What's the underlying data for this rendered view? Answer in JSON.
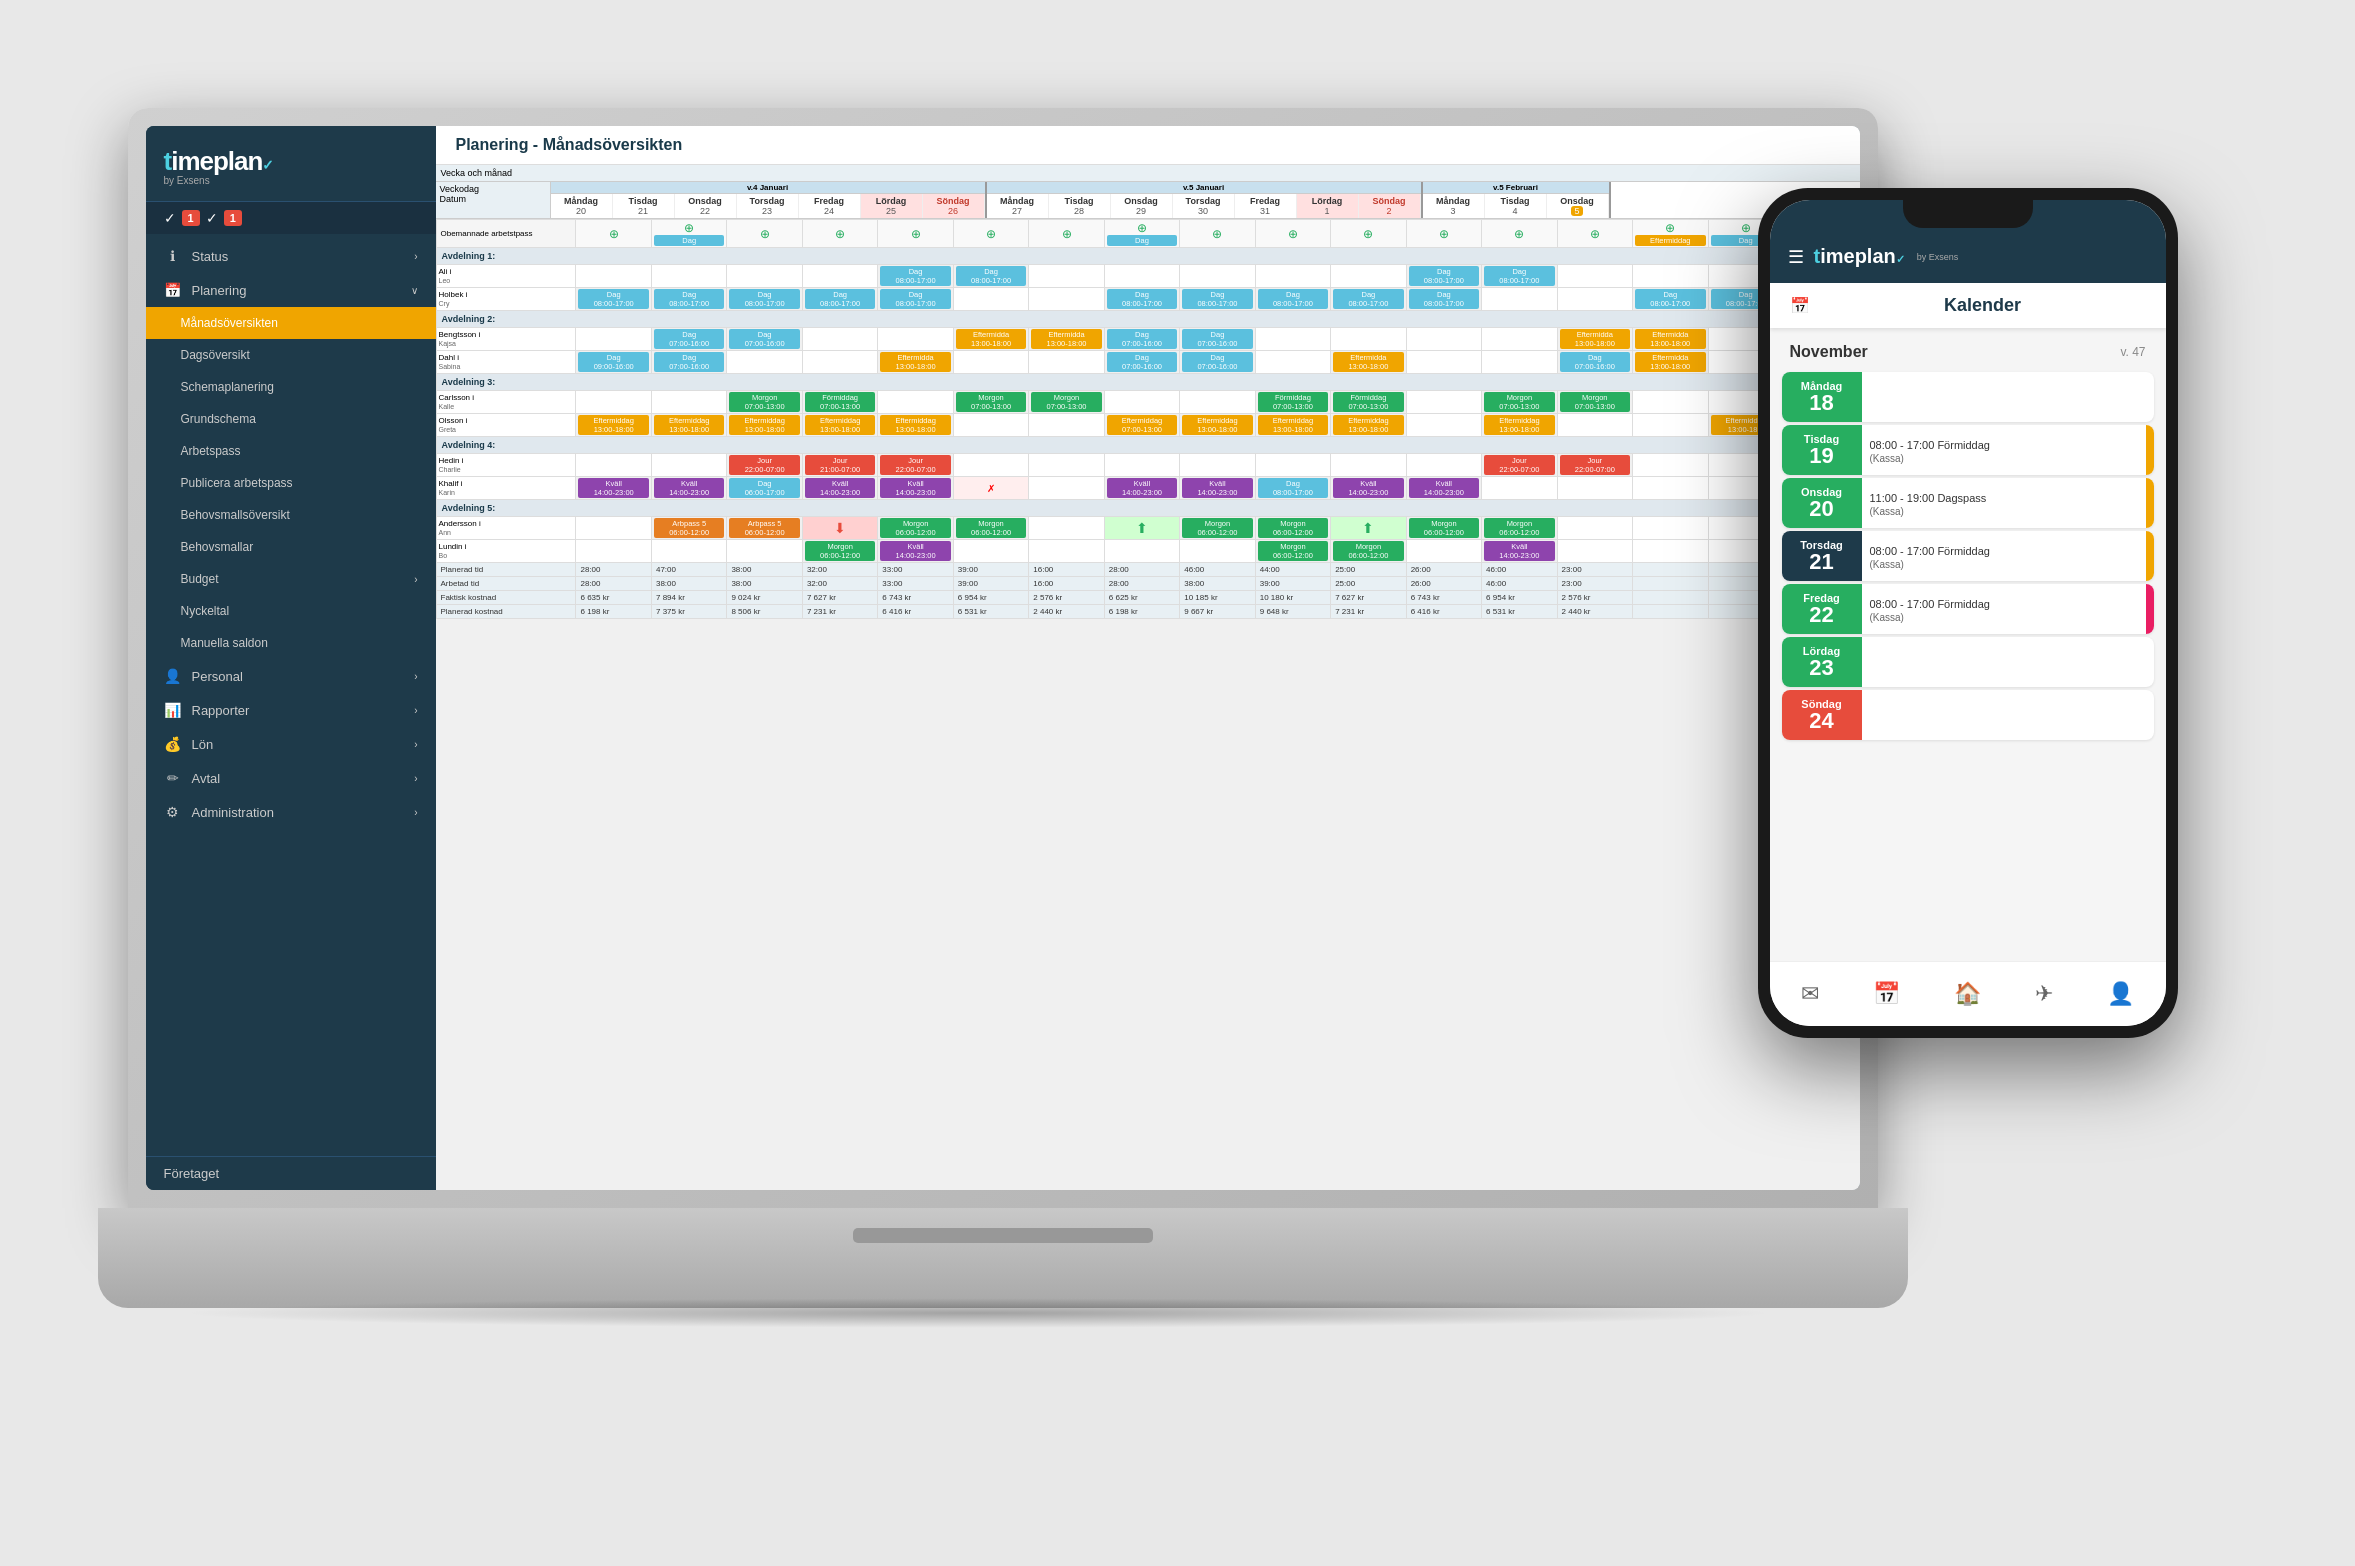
{
  "app": {
    "name": "timeplan",
    "name_accent": "t",
    "by": "by Exsens"
  },
  "laptop": {
    "page_title": "Planering - Månadsöversikten",
    "sidebar": {
      "notifications": [
        "1",
        "1"
      ],
      "nav_items": [
        {
          "id": "status",
          "label": "Status",
          "icon": "ℹ",
          "has_arrow": true
        },
        {
          "id": "planering",
          "label": "Planering",
          "icon": "📅",
          "has_arrow": true,
          "expanded": true
        },
        {
          "id": "manadsoverskiten",
          "label": "Månadsöversikten",
          "active": true,
          "sub": true
        },
        {
          "id": "dagsoverskiten",
          "label": "Dagsöversikt",
          "sub": true
        },
        {
          "id": "schemaplanering",
          "label": "Schemaplanering",
          "sub": true
        },
        {
          "id": "grundschema",
          "label": "Grundschema",
          "sub": true
        },
        {
          "id": "arbetspass",
          "label": "Arbetspass",
          "sub": true
        },
        {
          "id": "publicera",
          "label": "Publicera arbetspass",
          "sub": true
        },
        {
          "id": "behovsmalls",
          "label": "Behovsmallsöversikt",
          "sub": true
        },
        {
          "id": "behovsmallar",
          "label": "Behovsmallar",
          "sub": true
        },
        {
          "id": "budget",
          "label": "Budget",
          "sub": true,
          "has_arrow": true
        },
        {
          "id": "nyckeltal",
          "label": "Nyckeltal",
          "sub": true
        },
        {
          "id": "manuella",
          "label": "Manuella saldon",
          "sub": true
        },
        {
          "id": "personal",
          "label": "Personal",
          "icon": "👤",
          "has_arrow": true
        },
        {
          "id": "rapporter",
          "label": "Rapporter",
          "icon": "📊",
          "has_arrow": true
        },
        {
          "id": "lon",
          "label": "Lön",
          "icon": "💰",
          "has_arrow": true
        },
        {
          "id": "avtal",
          "label": "Avtal",
          "icon": "✏",
          "has_arrow": true
        },
        {
          "id": "administration",
          "label": "Administration",
          "icon": "⚙",
          "has_arrow": true
        }
      ],
      "footer": "Företaget"
    },
    "calendar": {
      "weeks": [
        {
          "number": "v.4",
          "month": "Januari"
        },
        {
          "number": "v.5",
          "month": "Januari"
        },
        {
          "number": "v.5",
          "month": "Februari"
        }
      ],
      "days": [
        {
          "name": "Måndag",
          "date": "20"
        },
        {
          "name": "Tisdag",
          "date": "21"
        },
        {
          "name": "Onsdag",
          "date": "22"
        },
        {
          "name": "Torsdag",
          "date": "23"
        },
        {
          "name": "Fredag",
          "date": "24"
        },
        {
          "name": "Lördag",
          "date": "25"
        },
        {
          "name": "Söndag",
          "date": "26",
          "weekend": true
        },
        {
          "name": "Måndag",
          "date": "27"
        },
        {
          "name": "Tisdag",
          "date": "28"
        },
        {
          "name": "Onsdag",
          "date": "29"
        },
        {
          "name": "Torsdag",
          "date": "30"
        },
        {
          "name": "Fredag",
          "date": "31"
        },
        {
          "name": "Lördag",
          "date": "1"
        },
        {
          "name": "Söndag",
          "date": "2",
          "weekend": true
        },
        {
          "name": "Måndag",
          "date": "3"
        },
        {
          "name": "Tisdag",
          "date": "4"
        },
        {
          "name": "Onsdag",
          "date": "5",
          "today": true
        }
      ]
    },
    "summary": {
      "planerad_tid_label": "Planerad tid",
      "arbetad_tid_label": "Arbetad tid",
      "faktisk_kostnad_label": "Faktisk kostnad",
      "planerad_kostnad_label": "Planerad kostnad"
    }
  },
  "phone": {
    "calendar_title": "Kalender",
    "month": "November",
    "week": "v. 47",
    "days": [
      {
        "name": "Måndag",
        "number": "18",
        "type": "green",
        "shifts": []
      },
      {
        "name": "Tisdag",
        "number": "19",
        "type": "green",
        "shifts": [
          {
            "time": "08:00 - 17:00 Förmiddag",
            "tag": "(Kassa)",
            "color": "orange"
          }
        ]
      },
      {
        "name": "Onsdag",
        "number": "20",
        "type": "green",
        "shifts": [
          {
            "time": "11:00 - 19:00 Dagspass",
            "tag": "(Kassa)",
            "color": "orange"
          }
        ]
      },
      {
        "name": "Torsdag",
        "number": "21",
        "type": "today",
        "shifts": [
          {
            "time": "08:00 - 17:00 Förmiddag",
            "tag": "(Kassa)",
            "color": "orange"
          }
        ]
      },
      {
        "name": "Fredag",
        "number": "22",
        "type": "green",
        "shifts": [
          {
            "time": "08:00 - 17:00 Förmiddag",
            "tag": "(Kassa)",
            "color": "pink"
          }
        ]
      },
      {
        "name": "Lördag",
        "number": "23",
        "type": "green",
        "shifts": []
      },
      {
        "name": "Söndag",
        "number": "24",
        "type": "sunday",
        "shifts": []
      }
    ],
    "bottom_nav": [
      {
        "icon": "✉",
        "id": "messages",
        "active": false
      },
      {
        "icon": "📅",
        "id": "calendar",
        "active": true
      },
      {
        "icon": "🏠",
        "id": "home",
        "active": false
      },
      {
        "icon": "✈",
        "id": "requests",
        "active": false
      },
      {
        "icon": "👤",
        "id": "profile",
        "active": false
      }
    ]
  },
  "cog_label": "Cog",
  "administration_label": "Administration"
}
